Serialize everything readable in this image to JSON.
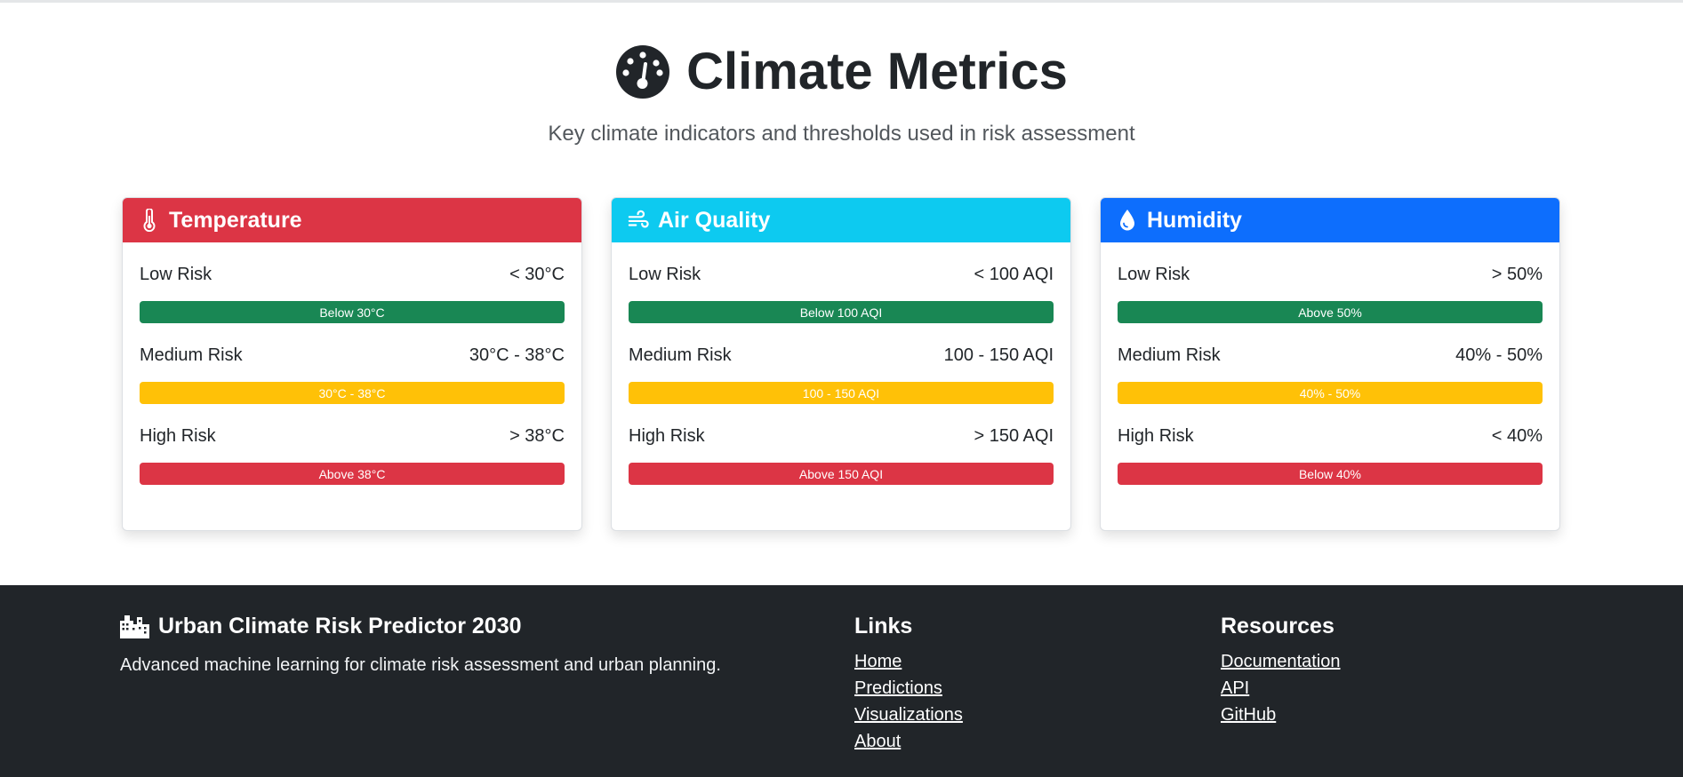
{
  "hero": {
    "title": "Climate Metrics",
    "subtitle": "Key climate indicators and thresholds used in risk assessment"
  },
  "colors": {
    "danger": "#dc3545",
    "info": "#0dcaf0",
    "primary": "#0d6efd",
    "success": "#198754",
    "warning": "#ffc107",
    "footer": "#212529"
  },
  "cards": [
    {
      "title": "Temperature",
      "icon": "thermometer-icon",
      "rows": [
        {
          "label": "Low Risk",
          "value": "< 30°C",
          "bar": "Below 30°C"
        },
        {
          "label": "Medium Risk",
          "value": "30°C - 38°C",
          "bar": "30°C - 38°C"
        },
        {
          "label": "High Risk",
          "value": "> 38°C",
          "bar": "Above 38°C"
        }
      ]
    },
    {
      "title": "Air Quality",
      "icon": "wind-icon",
      "rows": [
        {
          "label": "Low Risk",
          "value": "< 100 AQI",
          "bar": "Below 100 AQI"
        },
        {
          "label": "Medium Risk",
          "value": "100 - 150 AQI",
          "bar": "100 - 150 AQI"
        },
        {
          "label": "High Risk",
          "value": "> 150 AQI",
          "bar": "Above 150 AQI"
        }
      ]
    },
    {
      "title": "Humidity",
      "icon": "droplet-icon",
      "rows": [
        {
          "label": "Low Risk",
          "value": "> 50%",
          "bar": "Above 50%"
        },
        {
          "label": "Medium Risk",
          "value": "40% - 50%",
          "bar": "40% - 50%"
        },
        {
          "label": "High Risk",
          "value": "< 40%",
          "bar": "Below 40%"
        }
      ]
    }
  ],
  "footer": {
    "brand": "Urban Climate Risk Predictor 2030",
    "description": "Advanced machine learning for climate risk assessment and urban planning.",
    "links_heading": "Links",
    "links": [
      "Home",
      "Predictions",
      "Visualizations",
      "About"
    ],
    "resources_heading": "Resources",
    "resources": [
      "Documentation",
      "API",
      "GitHub"
    ]
  }
}
